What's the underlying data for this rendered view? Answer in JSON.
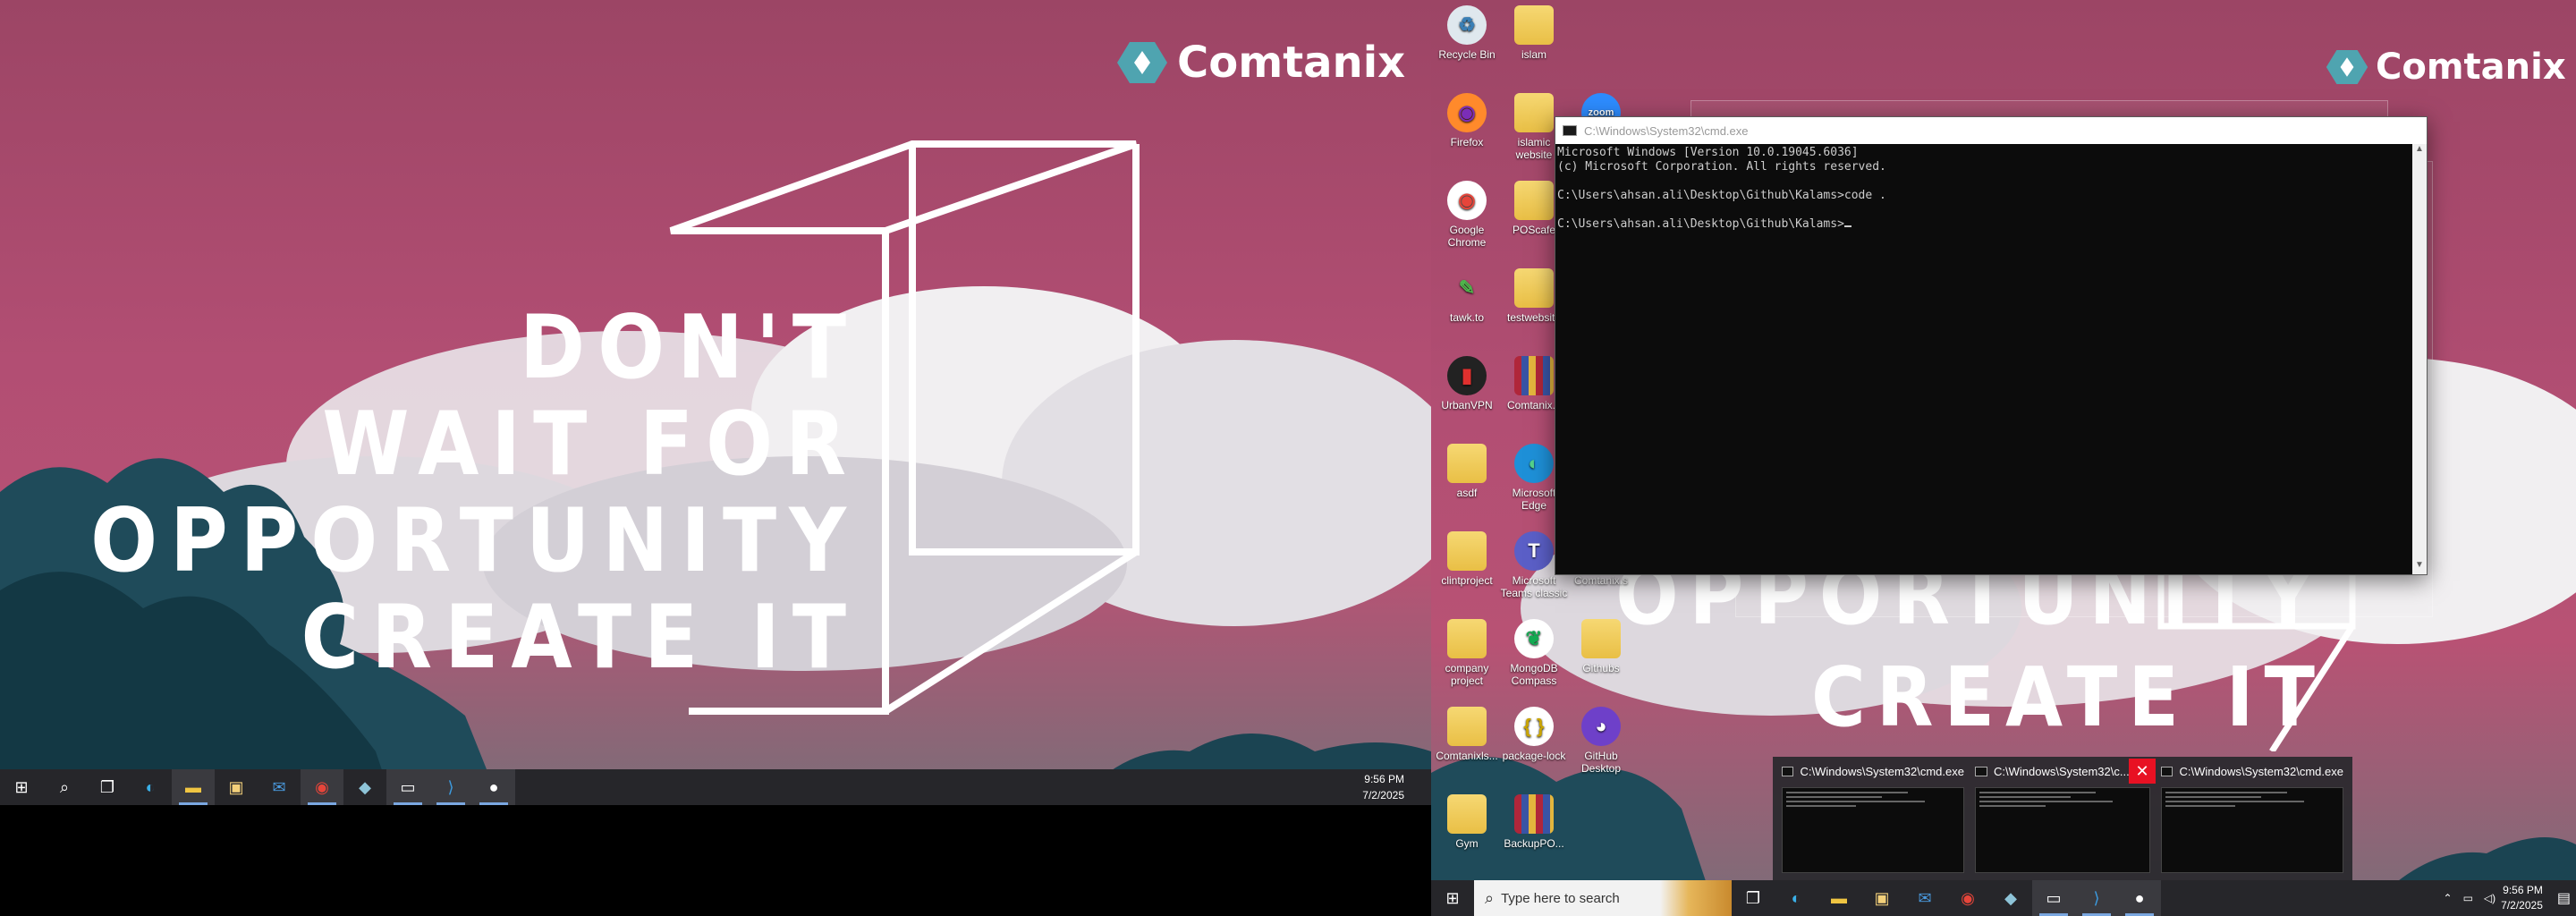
{
  "brand": {
    "name": "Comtanix"
  },
  "quote": {
    "line1": "DON'T",
    "line2": "WAIT FOR",
    "line3": "OPPORTUNITY",
    "line4": "CREATE IT"
  },
  "quote_right": {
    "line3": "OPPORTUNITY",
    "line4": "CREATE IT"
  },
  "taskbar_left": {
    "apps": [
      {
        "name": "start-icon",
        "glyph": "⊞"
      },
      {
        "name": "search-icon",
        "glyph": "⌕"
      },
      {
        "name": "task-view-icon",
        "glyph": "❐"
      },
      {
        "name": "edge-icon",
        "glyph": "◐"
      },
      {
        "name": "file-explorer-icon",
        "glyph": "▬"
      },
      {
        "name": "store-icon",
        "glyph": "▣"
      },
      {
        "name": "mail-icon",
        "glyph": "✉"
      },
      {
        "name": "chrome-icon",
        "glyph": "◉"
      },
      {
        "name": "app-icon",
        "glyph": "◆"
      },
      {
        "name": "cmd-icon",
        "glyph": "▭"
      },
      {
        "name": "vscode-icon",
        "glyph": "⟩"
      },
      {
        "name": "app2-icon",
        "glyph": "●"
      }
    ],
    "time": "9:56 PM",
    "date": "7/2/2025"
  },
  "desktop_icons": [
    {
      "label": "Recycle Bin",
      "type": "recycle"
    },
    {
      "label": "islam",
      "type": "folder"
    },
    {
      "label": "Firefox",
      "type": "firefox"
    },
    {
      "label": "islamic website",
      "type": "folder"
    },
    {
      "label": "Google Chrome",
      "type": "chrome"
    },
    {
      "label": "POScafe",
      "type": "folder"
    },
    {
      "label": "tawk.to",
      "type": "tawk"
    },
    {
      "label": "testwebsite",
      "type": "folder"
    },
    {
      "label": "UrbanVPN",
      "type": "vpn"
    },
    {
      "label": "Comtanix.s",
      "type": "archive"
    },
    {
      "label": "asdf",
      "type": "folder"
    },
    {
      "label": "Microsoft Edge",
      "type": "edge"
    },
    {
      "label": "clintproject",
      "type": "folder"
    },
    {
      "label": "Microsoft Teams classic",
      "type": "teams"
    },
    {
      "label": "Comtanix.s",
      "type": "folder"
    },
    {
      "label": "company project",
      "type": "folder"
    },
    {
      "label": "MongoDB Compass",
      "type": "mongo"
    },
    {
      "label": "Githubs",
      "type": "folder"
    },
    {
      "label": "Comtanixls...",
      "type": "folder"
    },
    {
      "label": "package-lock",
      "type": "json"
    },
    {
      "label": "GitHub Desktop",
      "type": "github"
    },
    {
      "label": "Gym",
      "type": "folder"
    },
    {
      "label": "BackupPO...",
      "type": "archive"
    },
    {
      "label": "zoom",
      "type": "zoom"
    }
  ],
  "cmd": {
    "title": "C:\\Windows\\System32\\cmd.exe",
    "lines": [
      "Microsoft Windows [Version 10.0.19045.6036]",
      "(c) Microsoft Corporation. All rights reserved.",
      "",
      "C:\\Users\\ahsan.ali\\Desktop\\Github\\Kalams>code .",
      "",
      "C:\\Users\\ahsan.ali\\Desktop\\Github\\Kalams>"
    ]
  },
  "thumbnails": [
    {
      "title": "C:\\Windows\\System32\\cmd.exe"
    },
    {
      "title": "C:\\Windows\\System32\\c..."
    },
    {
      "title": "C:\\Windows\\System32\\cmd.exe"
    }
  ],
  "taskbar_right": {
    "search_placeholder": "Type here to search",
    "time": "9:56 PM",
    "date": "7/2/2025"
  }
}
